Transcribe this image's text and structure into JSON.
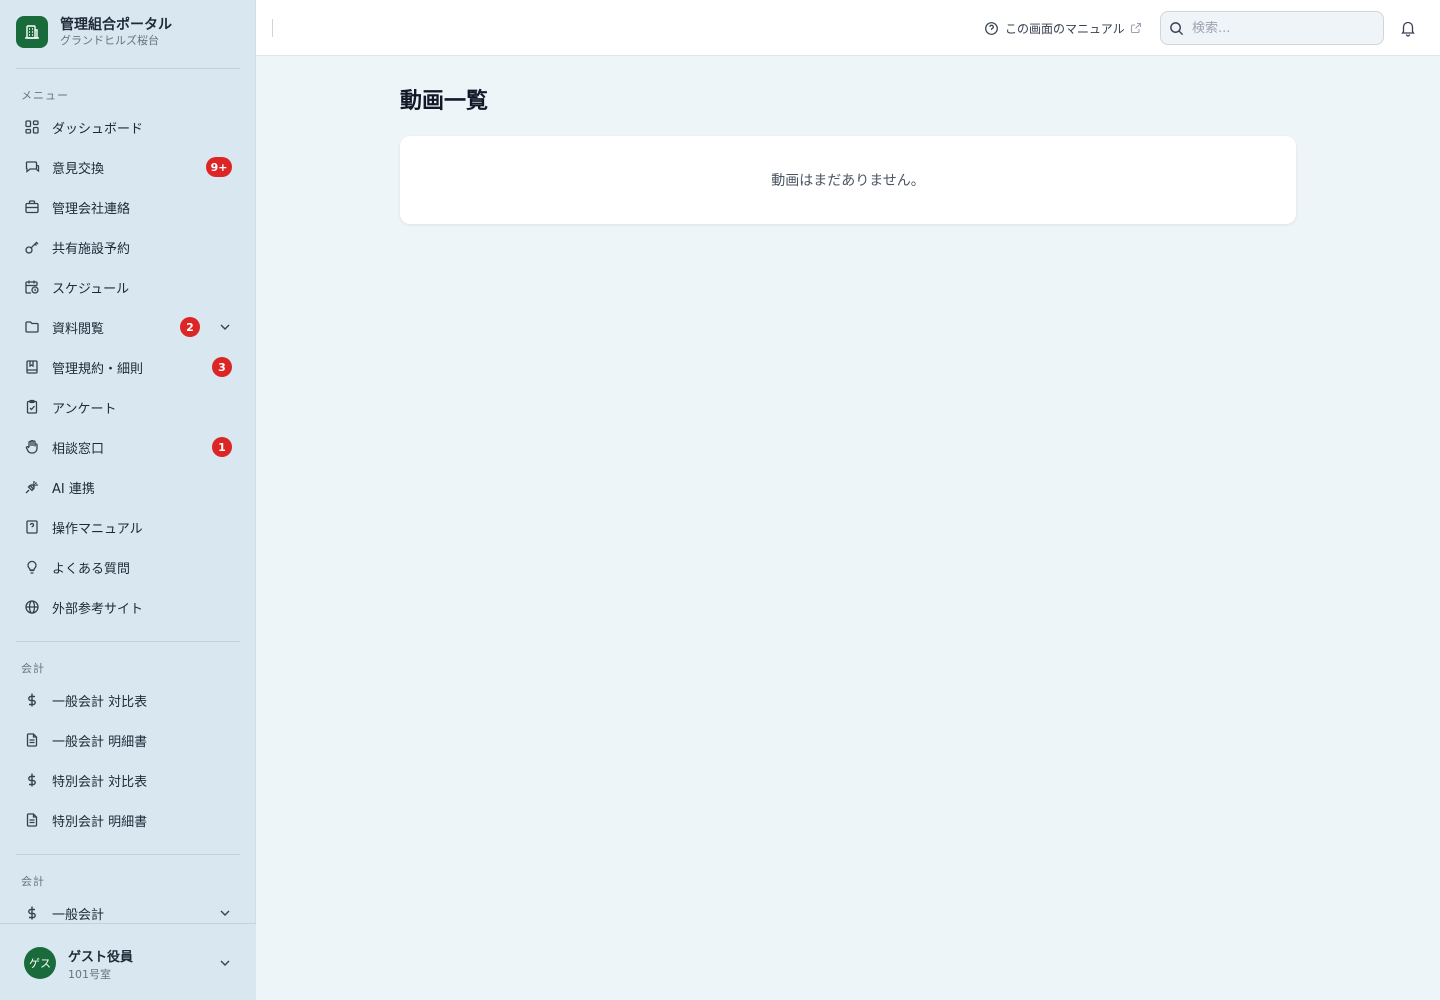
{
  "brand": {
    "title": "管理組合ポータル",
    "subtitle": "グランドヒルズ桜台"
  },
  "sidebar": {
    "menu_label": "メニュー",
    "items": [
      {
        "label": "ダッシュボード",
        "icon": "dashboard-icon"
      },
      {
        "label": "意見交換",
        "icon": "chat-icon",
        "badge": "9+"
      },
      {
        "label": "管理会社連絡",
        "icon": "briefcase-icon"
      },
      {
        "label": "共有施設予約",
        "icon": "key-icon"
      },
      {
        "label": "スケジュール",
        "icon": "calendar-clock-icon"
      },
      {
        "label": "資料閲覧",
        "icon": "folder-icon",
        "badge": "2"
      },
      {
        "label": "管理規約・細則",
        "icon": "book-icon",
        "badge": "3"
      },
      {
        "label": "アンケート",
        "icon": "clipboard-icon"
      },
      {
        "label": "相談窓口",
        "icon": "hand-icon",
        "badge": "1"
      },
      {
        "label": "AI 連携",
        "icon": "plug-icon"
      },
      {
        "label": "操作マニュアル",
        "icon": "manual-icon"
      },
      {
        "label": "よくある質問",
        "icon": "lightbulb-icon"
      },
      {
        "label": "外部参考サイト",
        "icon": "globe-icon"
      }
    ],
    "accounting_label": "会計",
    "accounting_items": [
      {
        "label": "一般会計 対比表",
        "icon": "dollar-icon"
      },
      {
        "label": "一般会計 明細書",
        "icon": "document-icon"
      },
      {
        "label": "特別会計 対比表",
        "icon": "dollar-icon"
      },
      {
        "label": "特別会計 明細書",
        "icon": "document-icon"
      }
    ],
    "accounting2_label": "会計",
    "accounting2_items": [
      {
        "label": "一般会計",
        "icon": "dollar-icon"
      }
    ]
  },
  "user": {
    "avatar": "ゲス",
    "name": "ゲスト役員",
    "room": "101号室"
  },
  "header": {
    "manual_link": "この画面のマニュアル",
    "search_placeholder": "検索..."
  },
  "main": {
    "title": "動画一覧",
    "empty_message": "動画はまだありません。"
  },
  "colors": {
    "brand": "#1a6b3c",
    "badge": "#dc2626",
    "sidebar_bg": "#d8e7f0",
    "main_bg": "#eef5f9"
  }
}
